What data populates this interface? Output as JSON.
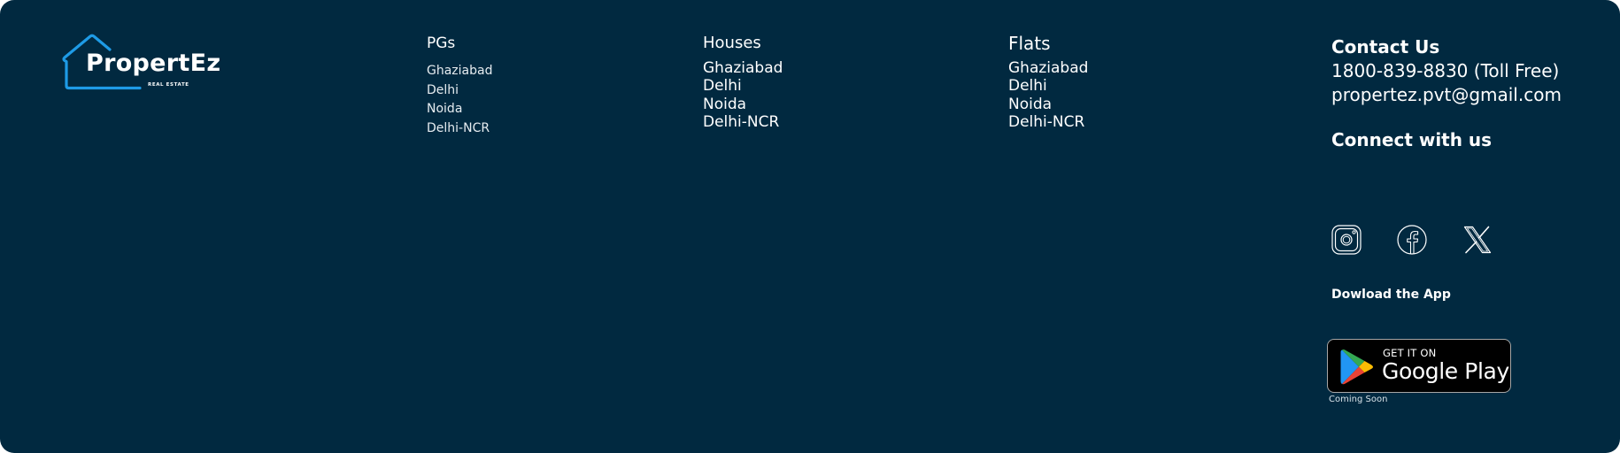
{
  "brand": {
    "name": "PropertEz",
    "tagline": "REAL ESTATE",
    "accent_color": "#1e9be6",
    "background_color": "#012940"
  },
  "columns": {
    "pgs": {
      "title": "PGs",
      "links": [
        "Ghaziabad",
        "Delhi",
        "Noida",
        "Delhi-NCR"
      ]
    },
    "houses": {
      "title": "Houses",
      "links": [
        "Ghaziabad",
        "Delhi",
        "Noida",
        "Delhi-NCR"
      ]
    },
    "flats": {
      "title": "Flats",
      "links": [
        "Ghaziabad",
        "Delhi",
        "Noida",
        "Delhi-NCR"
      ]
    }
  },
  "contact": {
    "heading": "Contact Us",
    "phone": "1800-839-8830 (Toll Free)",
    "email": "propertez.pvt@gmail.com"
  },
  "connect": {
    "heading": "Connect with us",
    "icons": [
      "instagram-icon",
      "facebook-icon",
      "x-icon"
    ]
  },
  "app": {
    "heading": "Dowload the App",
    "badge_small": "GET IT ON",
    "badge_large": "Google Play",
    "note": "Coming Soon"
  }
}
